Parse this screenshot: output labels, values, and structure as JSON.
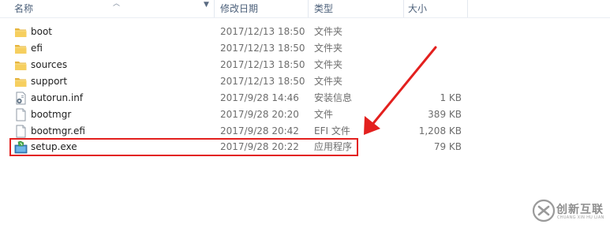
{
  "columns": {
    "name": "名称",
    "date": "修改日期",
    "type": "类型",
    "size": "大小"
  },
  "files": [
    {
      "icon": "folder-icon",
      "name": "boot",
      "date": "2017/12/13 18:50",
      "type": "文件夹",
      "size": ""
    },
    {
      "icon": "folder-icon",
      "name": "efi",
      "date": "2017/12/13 18:50",
      "type": "文件夹",
      "size": ""
    },
    {
      "icon": "folder-icon",
      "name": "sources",
      "date": "2017/12/13 18:50",
      "type": "文件夹",
      "size": ""
    },
    {
      "icon": "folder-icon",
      "name": "support",
      "date": "2017/12/13 18:50",
      "type": "文件夹",
      "size": ""
    },
    {
      "icon": "settings-file-icon",
      "name": "autorun.inf",
      "date": "2017/9/28 14:46",
      "type": "安装信息",
      "size": "1 KB"
    },
    {
      "icon": "file-icon",
      "name": "bootmgr",
      "date": "2017/9/28 20:20",
      "type": "文件",
      "size": "389 KB"
    },
    {
      "icon": "file-icon",
      "name": "bootmgr.efi",
      "date": "2017/9/28 20:42",
      "type": "EFI 文件",
      "size": "1,208 KB"
    },
    {
      "icon": "setup-exe-icon",
      "name": "setup.exe",
      "date": "2017/9/28 20:22",
      "type": "应用程序",
      "size": "79 KB"
    }
  ],
  "annotation": {
    "color": "#e3201e",
    "highlighted_file": "setup.exe"
  },
  "watermark": {
    "text": "创新互联",
    "subtext": "CHUANG XIN HU LIAN"
  }
}
